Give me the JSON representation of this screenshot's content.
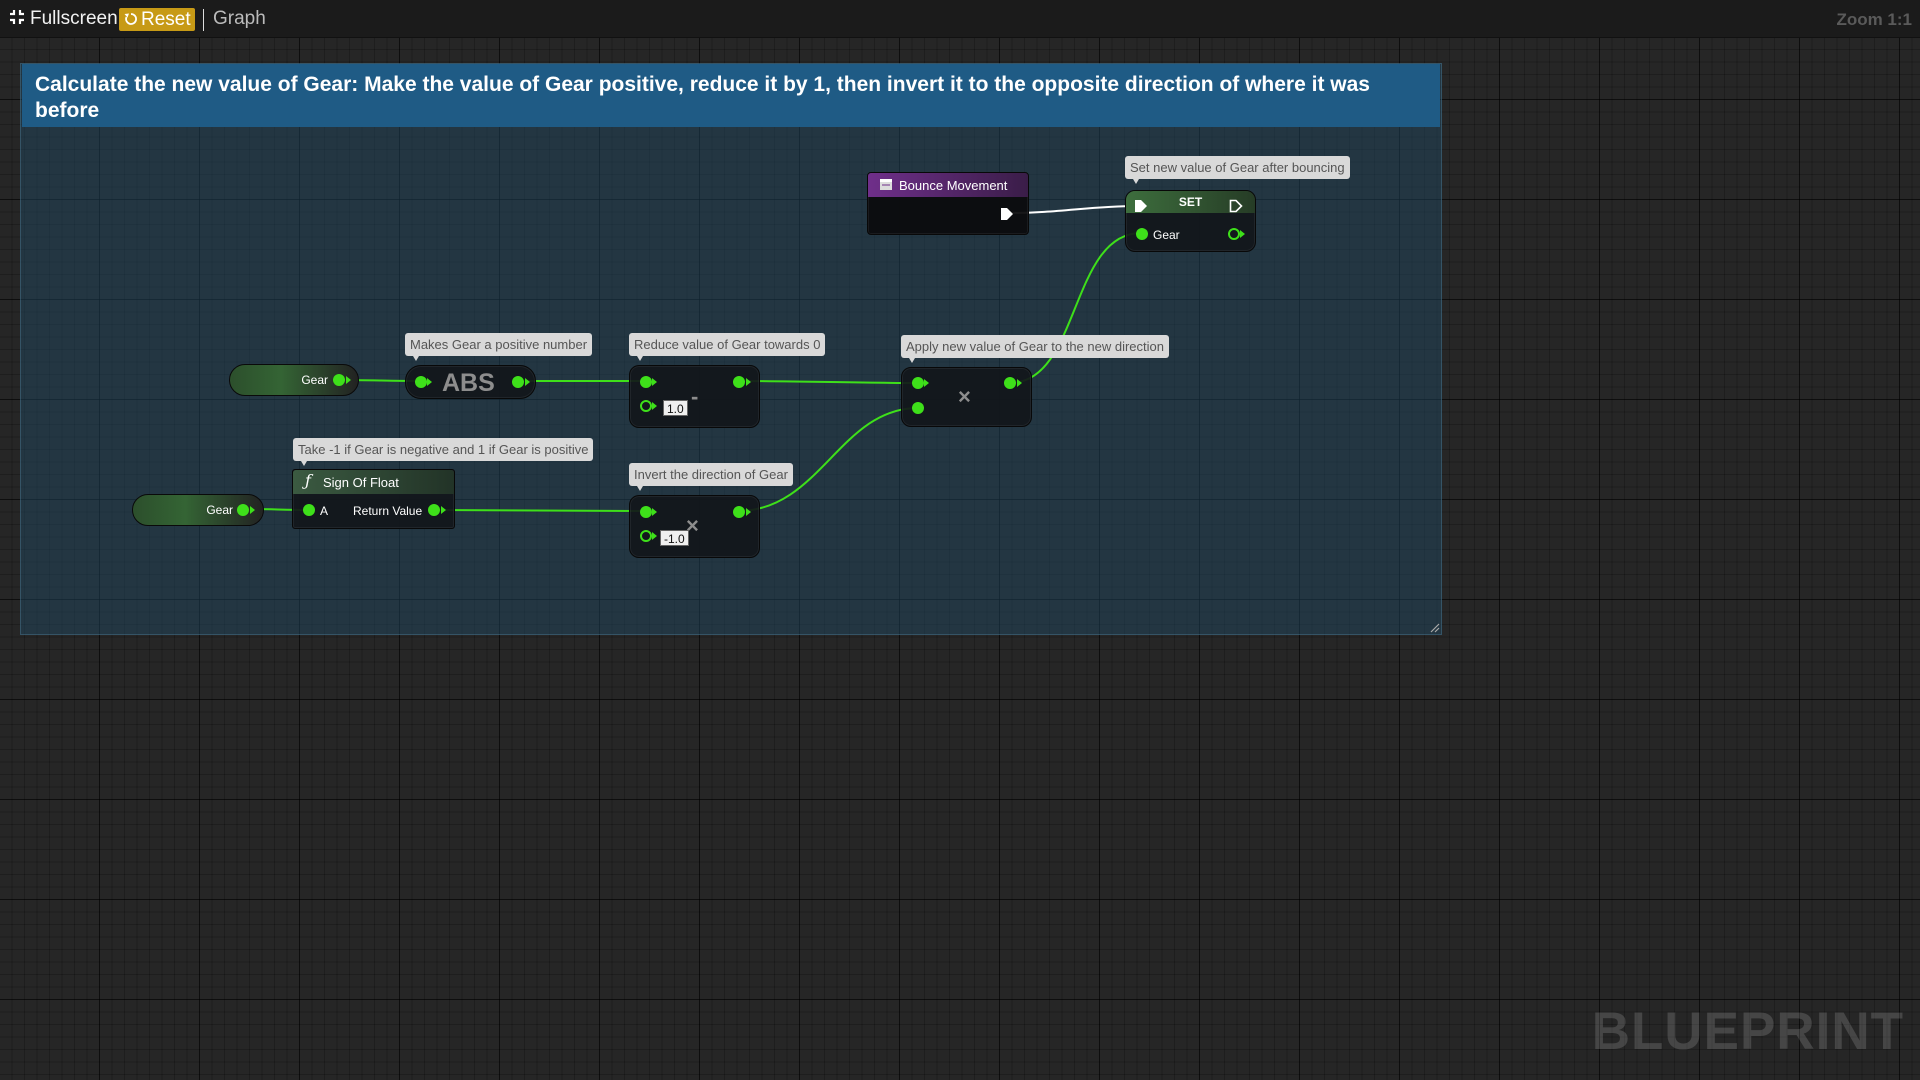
{
  "toolbar": {
    "fullscreen_label": "Fullscreen",
    "reset_label": "Reset",
    "graph_label": "Graph",
    "zoom_label": "Zoom 1:1"
  },
  "watermark": "BLUEPRINT",
  "comment_box": {
    "title": "Calculate the new value of Gear: Make the value of Gear positive, reduce it by 1, then invert it to the opposite direction of where it was before"
  },
  "nodes": {
    "gear_get_1": {
      "label": "Gear"
    },
    "gear_get_2": {
      "label": "Gear"
    },
    "abs": {
      "label": "ABS",
      "comment": "Makes Gear a positive number"
    },
    "subtract": {
      "glyph": "-",
      "b_value": "1.0",
      "comment": "Reduce value of Gear towards 0"
    },
    "sign_of_float": {
      "title": "Sign Of Float",
      "pin_a": "A",
      "pin_return": "Return Value",
      "comment": "Take -1 if Gear is negative and 1 if Gear is positive"
    },
    "multiply_invert": {
      "glyph": "×",
      "b_value": "-1.0",
      "comment": "Invert the direction of Gear"
    },
    "multiply_apply": {
      "glyph": "×",
      "comment": "Apply new value of Gear to the new direction"
    },
    "bounce_event": {
      "title": "Bounce Movement"
    },
    "set_gear": {
      "title": "SET",
      "pin": "Gear",
      "comment": "Set new value of Gear after bouncing"
    }
  },
  "colors": {
    "float_pin": "#3ee01a",
    "comment_header": "#1f5b85",
    "event_header": "#6f2f8a",
    "reset_button": "#c79a16"
  }
}
